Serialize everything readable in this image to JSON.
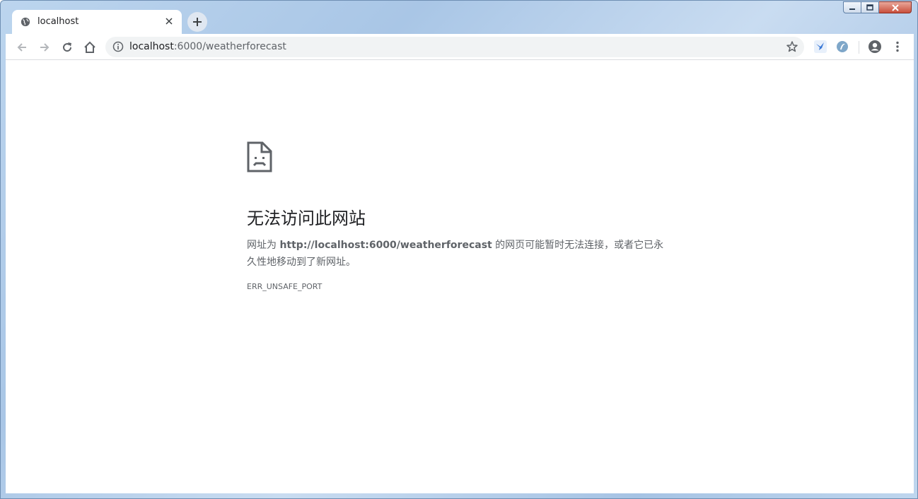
{
  "tab": {
    "title": "localhost",
    "favicon": "globe-icon",
    "close_label": "×"
  },
  "new_tab": {
    "icon": "plus-icon"
  },
  "window_controls": [
    "minimize",
    "maximize",
    "close"
  ],
  "toolbar": {
    "back_icon": "arrow-left-icon",
    "forward_icon": "arrow-right-icon",
    "reload_icon": "reload-icon",
    "home_icon": "home-icon"
  },
  "omnibox": {
    "host": "localhost",
    "path": ":6000/weatherforecast"
  },
  "error": {
    "heading": "无法访问此网站",
    "message_prefix": "网址为 ",
    "url": "http://localhost:6000/weatherforecast",
    "message_suffix": " 的网页可能暂时无法连接，或者它已永久性地移动到了新网址。",
    "code": "ERR_UNSAFE_PORT"
  },
  "colors": {
    "frame": "#bcd5ee",
    "text_primary": "#202124",
    "text_secondary": "#5f6368",
    "omnibox_bg": "#f1f3f4"
  }
}
